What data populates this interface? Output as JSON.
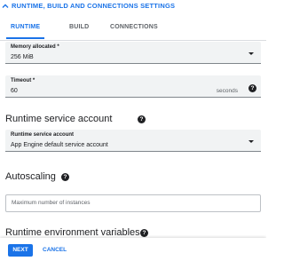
{
  "section": {
    "title": "RUNTIME, BUILD AND CONNECTIONS SETTINGS",
    "icon": "chevron-up-icon"
  },
  "tabs": [
    {
      "label": "RUNTIME",
      "active": true
    },
    {
      "label": "BUILD",
      "active": false
    },
    {
      "label": "CONNECTIONS",
      "active": false
    }
  ],
  "memory": {
    "label": "Memory allocated *",
    "value": "256 MiB"
  },
  "timeout": {
    "label": "Timeout *",
    "value": "60",
    "suffix": "seconds"
  },
  "runtime_service_account": {
    "heading": "Runtime service account",
    "label": "Runtime service account",
    "value": "App Engine default service account"
  },
  "autoscaling": {
    "heading": "Autoscaling",
    "placeholder": "Maximum number of instances"
  },
  "env_vars": {
    "heading": "Runtime environment variables"
  },
  "footer": {
    "next_label": "NEXT",
    "cancel_label": "CANCEL"
  },
  "colors": {
    "accent": "#1a73e8",
    "field_bg": "#f1f3f4"
  }
}
